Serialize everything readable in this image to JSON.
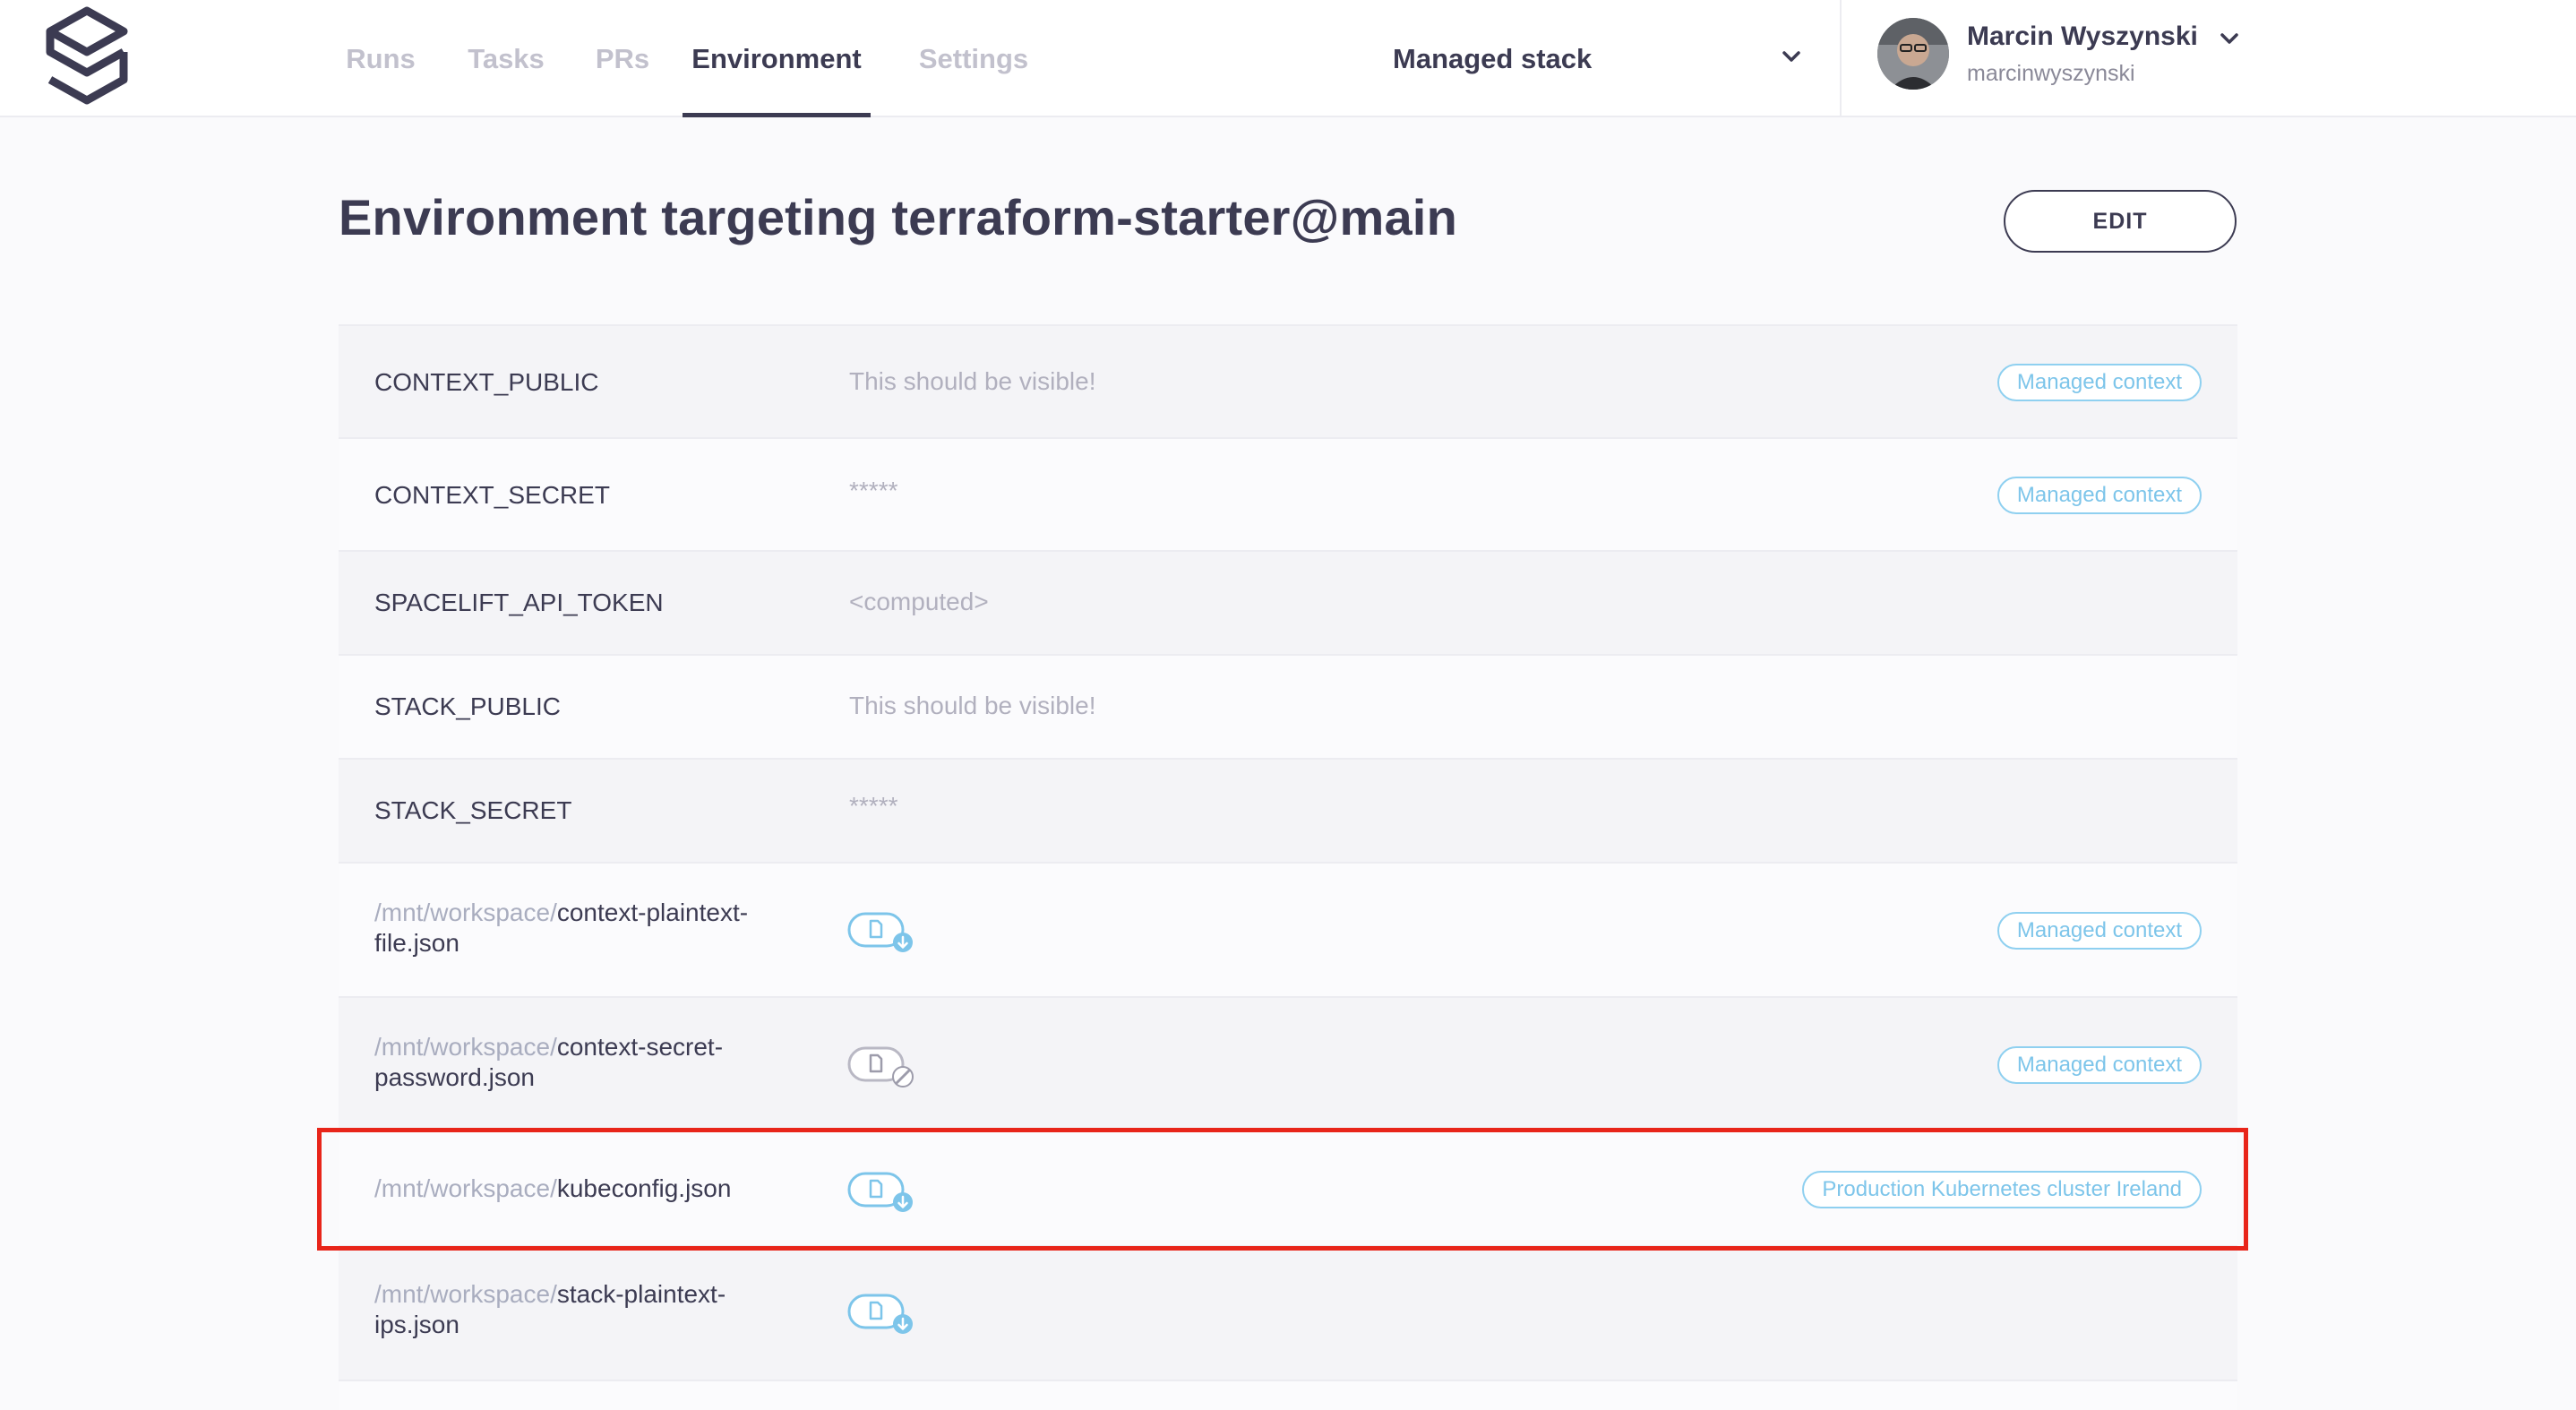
{
  "nav": {
    "tabs": [
      {
        "label": "Runs"
      },
      {
        "label": "Tasks"
      },
      {
        "label": "PRs"
      },
      {
        "label": "Environment"
      },
      {
        "label": "Settings"
      }
    ],
    "active_tab": "Environment"
  },
  "stack_selector": {
    "label": "Managed stack",
    "icon": "chevron-down-icon"
  },
  "user": {
    "name": "Marcin Wyszynski",
    "handle": "marcinwyszynski"
  },
  "page": {
    "title": "Environment targeting terraform-starter@main",
    "edit_label": "EDIT"
  },
  "env": {
    "rows": [
      {
        "name": "CONTEXT_PUBLIC",
        "value": "This should be visible!",
        "badge": "Managed context"
      },
      {
        "name": "CONTEXT_SECRET",
        "value": "*****",
        "badge": "Managed context"
      },
      {
        "name": "SPACELIFT_API_TOKEN",
        "value": "<computed>"
      },
      {
        "name": "STACK_PUBLIC",
        "value": "This should be visible!"
      },
      {
        "name": "STACK_SECRET",
        "value": "*****"
      }
    ],
    "files": [
      {
        "path": "/mnt/workspace/",
        "file_line1": "context-plaintext-",
        "file_line2": "file.json",
        "icon": "file-download-icon",
        "badge": "Managed context"
      },
      {
        "path": "/mnt/workspace/",
        "file_line1": "context-secret-",
        "file_line2": "password.json",
        "icon": "file-secret-icon",
        "badge": "Managed context"
      },
      {
        "path": "/mnt/workspace/",
        "file_line1": "kubeconfig.json",
        "icon": "file-download-icon",
        "badge": "Production Kubernetes cluster Ireland"
      },
      {
        "path": "/mnt/workspace/",
        "file_line1": "stack-plaintext-",
        "file_line2": "ips.json",
        "icon": "file-download-icon"
      }
    ]
  },
  "colors": {
    "accent_text": "#3c3b52",
    "badge_blue": "#7dc5ea",
    "highlight_red": "#e8251a"
  }
}
